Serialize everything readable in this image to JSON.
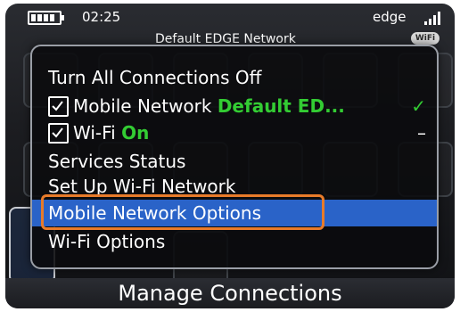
{
  "status_bar": {
    "time": "02:25",
    "network_type": "edge",
    "network_name": "Default EDGE Network",
    "wifi_badge": "WiFi",
    "battery_icon": "battery-icon",
    "signal_icon": "signal-strength-icon"
  },
  "menu": {
    "items": [
      {
        "label": "Turn All Connections Off"
      },
      {
        "label": "Mobile Network",
        "status": "Default ED...",
        "checked": true,
        "status_mark": "✓"
      },
      {
        "label": "Wi-Fi",
        "status": "On",
        "checked": true,
        "status_mark": "–"
      },
      {
        "label": "Services Status"
      },
      {
        "label": "Set Up Wi-Fi Network"
      },
      {
        "label": "Mobile Network Options",
        "selected": true
      },
      {
        "label": "Wi-Fi Options"
      }
    ]
  },
  "screen": {
    "title": "Manage Connections"
  },
  "colors": {
    "selection": "#2a63c8",
    "status_green": "#33cc33",
    "highlight_frame": "#e87b2a"
  }
}
